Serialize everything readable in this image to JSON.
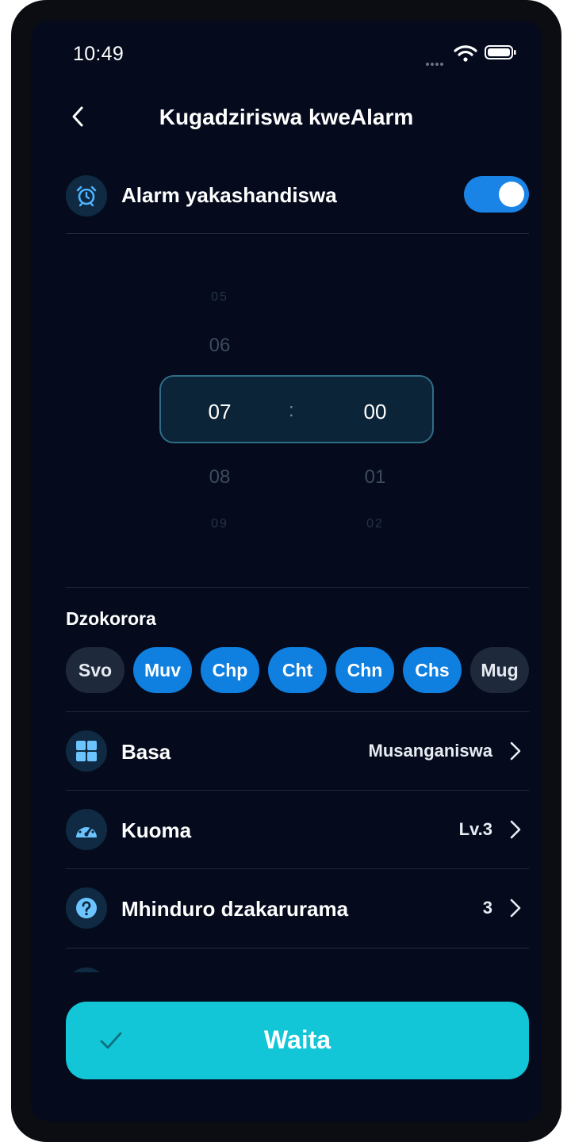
{
  "status_bar": {
    "time": "10:49"
  },
  "header": {
    "title": "Kugadziriswa kweAlarm"
  },
  "alarm_toggle": {
    "label": "Alarm yakashandiswa",
    "enabled": true
  },
  "time_picker": {
    "hours": {
      "far_above": "05",
      "above": "06",
      "selected": "07",
      "below": "08",
      "far_below": "09"
    },
    "separator": ":",
    "minutes": {
      "selected": "00",
      "below": "01",
      "far_below": "02"
    }
  },
  "repeat": {
    "label": "Dzokorora",
    "days": [
      {
        "label": "Svo",
        "active": false
      },
      {
        "label": "Muv",
        "active": true
      },
      {
        "label": "Chp",
        "active": true
      },
      {
        "label": "Cht",
        "active": true
      },
      {
        "label": "Chn",
        "active": true
      },
      {
        "label": "Chs",
        "active": true
      },
      {
        "label": "Mug",
        "active": false
      }
    ]
  },
  "settings": [
    {
      "label": "Basa",
      "value": "Musanganiswa",
      "icon": "grid-icon"
    },
    {
      "label": "Kuoma",
      "value": "Lv.3",
      "icon": "gauge-icon"
    },
    {
      "label": "Mhinduro dzakarurama",
      "value": "3",
      "icon": "question-icon"
    }
  ],
  "save_button": {
    "label": "Waita"
  },
  "colors": {
    "accent": "#12c6d8",
    "toggle_on": "#1a83e6",
    "day_active": "#0f7fe0",
    "background": "#050b1d"
  }
}
